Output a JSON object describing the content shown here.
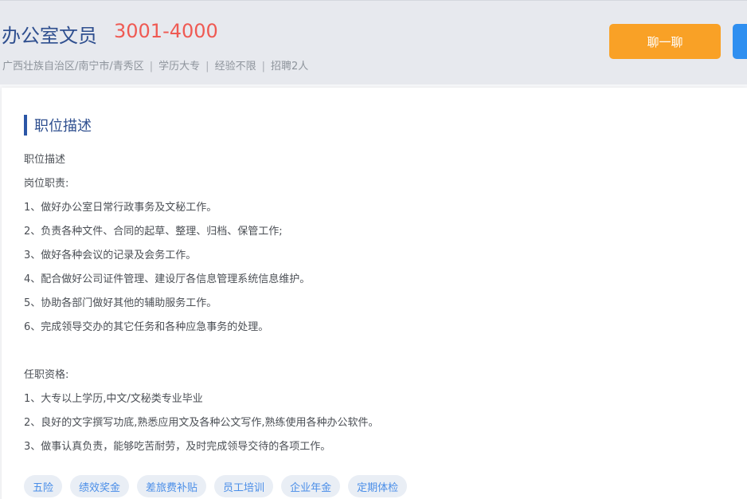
{
  "job": {
    "title": "办公室文员",
    "salary": "3001-4000",
    "meta": [
      "广西壮族自治区/南宁市/青秀区",
      "学历大专",
      "经验不限",
      "招聘2人"
    ],
    "meta_separator": "|",
    "chat_button": "聊一聊"
  },
  "section": {
    "title": "职位描述"
  },
  "description_lines": [
    "职位描述",
    "岗位职责:",
    "1、做好办公室日常行政事务及文秘工作。",
    "2、负责各种文件、合同的起草、整理、归档、保管工作;",
    "3、做好各种会议的记录及会务工作。",
    "4、配合做好公司证件管理、建设厅各信息管理系统信息维护。",
    "5、协助各部门做好其他的辅助服务工作。",
    "6、完成领导交办的其它任务和各种应急事务的处理。",
    "",
    "任职资格:",
    "1、大专以上学历,中文/文秘类专业毕业",
    "2、良好的文字撰写功底,熟悉应用文及各种公文写作,熟练使用各种办公软件。",
    "3、做事认真负责，能够吃苦耐劳，及时完成领导交待的各项工作。"
  ],
  "tags": [
    "五险",
    "绩效奖金",
    "差旅费补贴",
    "员工培训",
    "企业年金",
    "定期体检"
  ],
  "colors": {
    "title": "#2f4f8f",
    "salary": "#ef5a53",
    "chat_button": "#f9a126",
    "accent_bar": "#2b56a6",
    "tag_text": "#4a8ee8",
    "tag_bg": "#e9eef5"
  }
}
